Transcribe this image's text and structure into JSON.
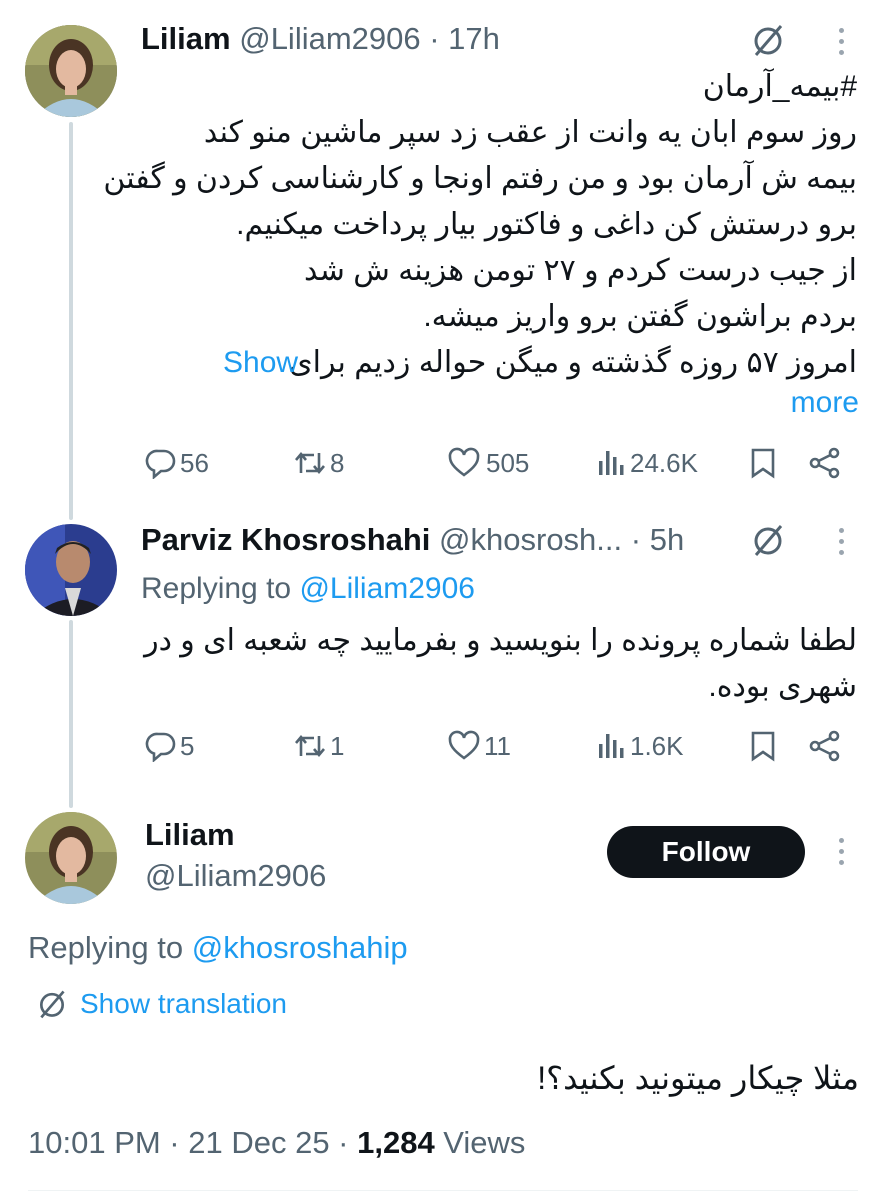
{
  "tweet1": {
    "name": "Liliam",
    "handle": "@Liliam2906",
    "time": "· 17h",
    "hashtag": "#بیمه_آرمان",
    "lines": [
      "روز سوم ابان یه وانت از عقب زد سپر ماشین منو کند",
      "بیمه ش آرمان بود و من رفتم اونجا و کارشناسی کردن و گفتن",
      "برو درستش کن داغی و فاکتور بیار پرداخت میکنیم.",
      "از جیب درست کردم و ۲۷ تومن هزینه ش شد",
      "بردم براشون گفتن برو واریز میشه.",
      "امروز ۵۷ روزه گذشته و میگن حواله زدیم برای"
    ],
    "show_more_1": "Show",
    "show_more_2": "more",
    "replies": "56",
    "retweets": "8",
    "likes": "505",
    "views": "24.6K"
  },
  "tweet2": {
    "name": "Parviz Khosroshahi",
    "handle": "@khosrosh...",
    "time": "· 5h",
    "replying_label": "Replying to",
    "replying_handle": "@Liliam2906",
    "lines": [
      "لطفا شماره پرونده را بنویسید و بفرمایید چه شعبه ای و در",
      "شهری بوده."
    ],
    "replies": "5",
    "retweets": "1",
    "likes": "11",
    "views": "1.6K"
  },
  "tweet3": {
    "name": "Liliam",
    "handle": "@Liliam2906",
    "follow_label": "Follow",
    "replying_label": "Replying to",
    "replying_handle": "@khosroshahip",
    "show_translation": "Show translation",
    "text": "مثلا چیکار میتونید بکنید؟!",
    "timestamp": "10:01 PM · 21 Dec 25 · ",
    "views_count": "1,284",
    "views_label": " Views"
  },
  "colors": {
    "accent": "#1d9bf0",
    "muted": "#536471",
    "text": "#0f1419",
    "follow_bg": "#0f1419"
  },
  "icons": [
    "grok-translate-icon",
    "more-dots-icon",
    "reply-icon",
    "retweet-icon",
    "like-icon",
    "views-icon",
    "bookmark-icon",
    "share-icon"
  ]
}
